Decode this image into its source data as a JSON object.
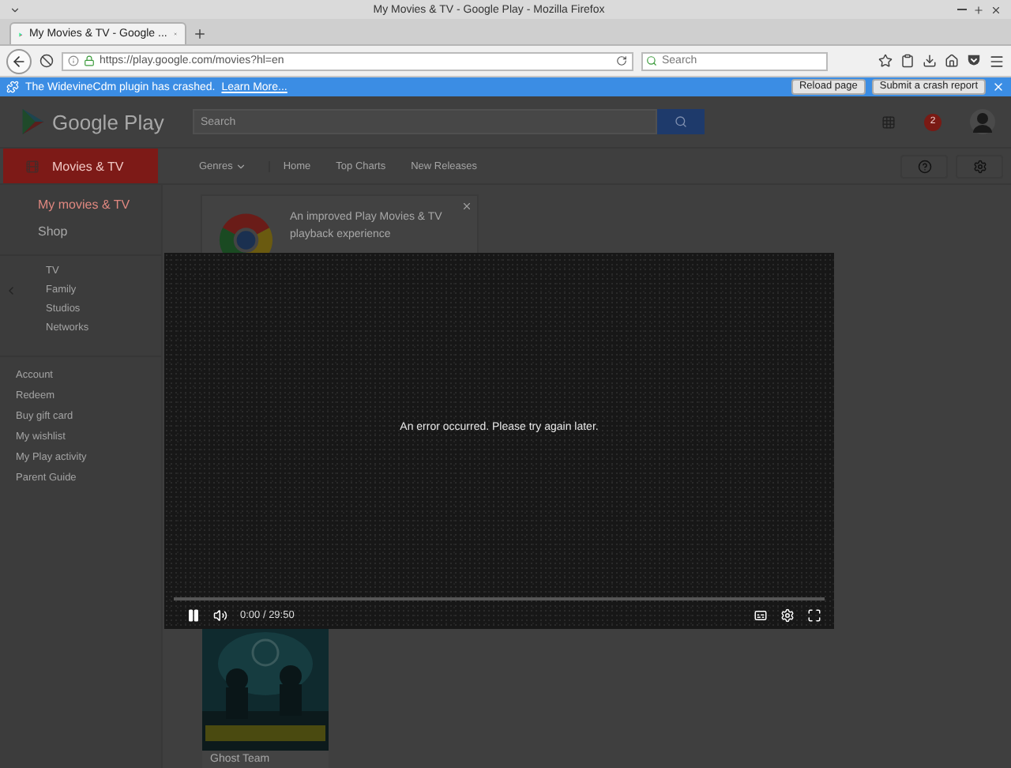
{
  "window": {
    "title": "My Movies & TV - Google Play - Mozilla Firefox"
  },
  "browser_tabs": [
    {
      "label": "My Movies & TV - Google ...",
      "selected": true
    }
  ],
  "address_bar": {
    "url": "https://play.google.com/movies?hl=en"
  },
  "browser_search": {
    "placeholder": "Search"
  },
  "notification": {
    "message": "The WidevineCdm plugin has crashed.",
    "link": "Learn More...",
    "buttons": [
      "Reload page",
      "Submit a crash report"
    ]
  },
  "header": {
    "logo": "Google Play",
    "search_placeholder": "Search",
    "notification_count": "2"
  },
  "category": {
    "label": "Movies & TV"
  },
  "nav_links": [
    "Genres",
    "Home",
    "Top Charts",
    "New Releases"
  ],
  "sidebar": {
    "items": [
      {
        "label": "My movies & TV",
        "selected": true
      },
      {
        "label": "Shop",
        "selected": false
      }
    ],
    "browse": [
      "TV",
      "Family",
      "Studios",
      "Networks"
    ],
    "links": [
      "Account",
      "Redeem",
      "Buy gift card",
      "My wishlist",
      "My Play activity",
      "Parent Guide"
    ]
  },
  "promo": {
    "text": "An improved Play Movies & TV playback experience"
  },
  "movies": [
    {
      "title": "Ghost Team",
      "kind": "picture"
    }
  ],
  "player": {
    "message": "An error occurred. Please try again later.",
    "time": "0:00 / 29:50",
    "level": 0,
    "playing": true
  }
}
